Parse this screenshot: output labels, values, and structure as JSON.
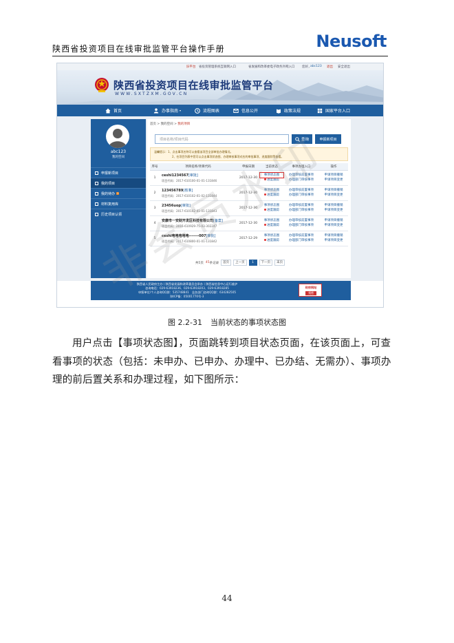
{
  "doc": {
    "header_title": "陕西省投资项目在线审批监管平台操作手册",
    "brand": "Neusoft",
    "caption_number": "图 2.2-31",
    "caption_text": "当前状态的事项状态图",
    "paragraph": "用户点击【事项状态图】，页面跳转到项目状态页面，在该页面上，可查看事项的状态（包括：未申办、已申办、办理中、已办结、无需办）、事项办理的前后置关系和办理过程，如下图所示：",
    "page_number": "44",
    "watermark": "非会员水印"
  },
  "app": {
    "topbar": {
      "links": [
        "旧平台",
        "省投资管理系统互联网入口",
        "省发展和改革委电子政务外网入口",
        "您好，",
        "abc123",
        "退出",
        "安全退出"
      ]
    },
    "site": {
      "title": "陕西省投资项目在线审批监管平台",
      "url": "WWW.SXTZXM.GOV.CN"
    },
    "nav": [
      "首页",
      "办事指南",
      "流程图表",
      "信息公开",
      "政策法规",
      "国家平台入口"
    ],
    "user": {
      "name": "abc123",
      "link": "我的空间"
    },
    "side_menu": [
      {
        "label": "申报新项目"
      },
      {
        "label": "我的项目"
      },
      {
        "label": "我的待办",
        "badge": "1"
      },
      {
        "label": "材料复用库"
      },
      {
        "label": "历史项目认领"
      }
    ],
    "breadcrumb": {
      "home": "首页",
      "sep": " > ",
      "space": "我的空间",
      "current": "我的项目"
    },
    "search": {
      "placeholder": "项目名称/项目代码",
      "query_label": "查询",
      "new_label": "申报新项目"
    },
    "notice": {
      "line1": "温馨提示：1、点击事项名称可以查看该项目全部审批办理情况。",
      "line2": "2、在项目列表中您可以点击事项状态图、办理审核事项对应的审批事项、进度跟踪等查看。"
    },
    "table": {
      "headers": [
        "序号",
        "项目名称/项目代码",
        "申报日期",
        "当前状态",
        "事项办理入口",
        "操作"
      ],
      "rows": [
        {
          "no": "1",
          "name": "ceshi1234567",
          "tag": "[审批]",
          "code": "项目代码：2017-610100-01-01-131846",
          "date": "2017-12-30",
          "status": "事项状态图",
          "progress": "进度跟踪",
          "entry1": "办理审核前置事项",
          "entry2": "办理部门审核事项",
          "op1": "申请项目撤销",
          "op2": "申请项目变更"
        },
        {
          "no": "2",
          "name": "123456789",
          "tag": "[核准]",
          "code": "项目代码：2017-610102-01-02-131844",
          "date": "2017-12-30",
          "status": "事项状态图",
          "progress": "进度跟踪",
          "entry1": "办理审核前置事项",
          "entry2": "办理部门审核事项",
          "op1": "申请项目撤销",
          "op2": "申请项目变更"
        },
        {
          "no": "3",
          "name": "23456uop",
          "tag": "[审批]",
          "code": "项目代码：2017-610102-01-01-131843",
          "date": "2017-12-30",
          "status": "事项状态图",
          "progress": "进度跟踪",
          "entry1": "办理审核前置事项",
          "entry2": "办理部门审核事项",
          "op1": "申请项目撤销",
          "op2": "申请项目变更"
        },
        {
          "no": "4",
          "name": "安康市一安财开发区科技有限公司",
          "tag": "[备案]",
          "code": "项目代码：2016-610929-75-03-302247",
          "date": "2017-12-30",
          "status": "事项状态图",
          "progress": "进度跟踪",
          "entry1": "办理审核前置事项",
          "entry2": "办理部门审核事项",
          "op1": "申请项目撤销",
          "op2": "申请项目变更"
        },
        {
          "no": "5",
          "name": "ceshi咯咯咯咯咯-------007",
          "tag": "[审批]",
          "code": "项目代码：2017-610800-01-01-131842",
          "date": "2017-12-29",
          "status": "事项状态图",
          "progress": "进度跟踪",
          "entry1": "办理审核前置事项",
          "entry2": "办理部门审核事项",
          "op1": "申请项目撤销",
          "op2": "申请项目变更"
        }
      ]
    },
    "pager": {
      "total_prefix": "共5页",
      "total": "45",
      "total_suffix": "条记录",
      "first": "首页",
      "prev": "上一页",
      "current": "1",
      "next": "下一页",
      "last": "末页"
    },
    "footer": {
      "line1": "陕西省人民政府主办丨陕西省发展和改革委员会承办丨陕西省信息中心运行维护",
      "line2": "咨询电话：029-63918236、029-63918203、029-63918285",
      "line3": "申报单位/个人咨询QQ群：535748841　业务部门咨询QQ群：634282505",
      "line4": "陕ICP备：05001770号-3",
      "badge_top": "政府网站",
      "badge_bottom": "找错"
    }
  },
  "colors": {
    "primary": "#1f5e9e",
    "brand": "#1a58b0",
    "highlight": "#e02020"
  }
}
